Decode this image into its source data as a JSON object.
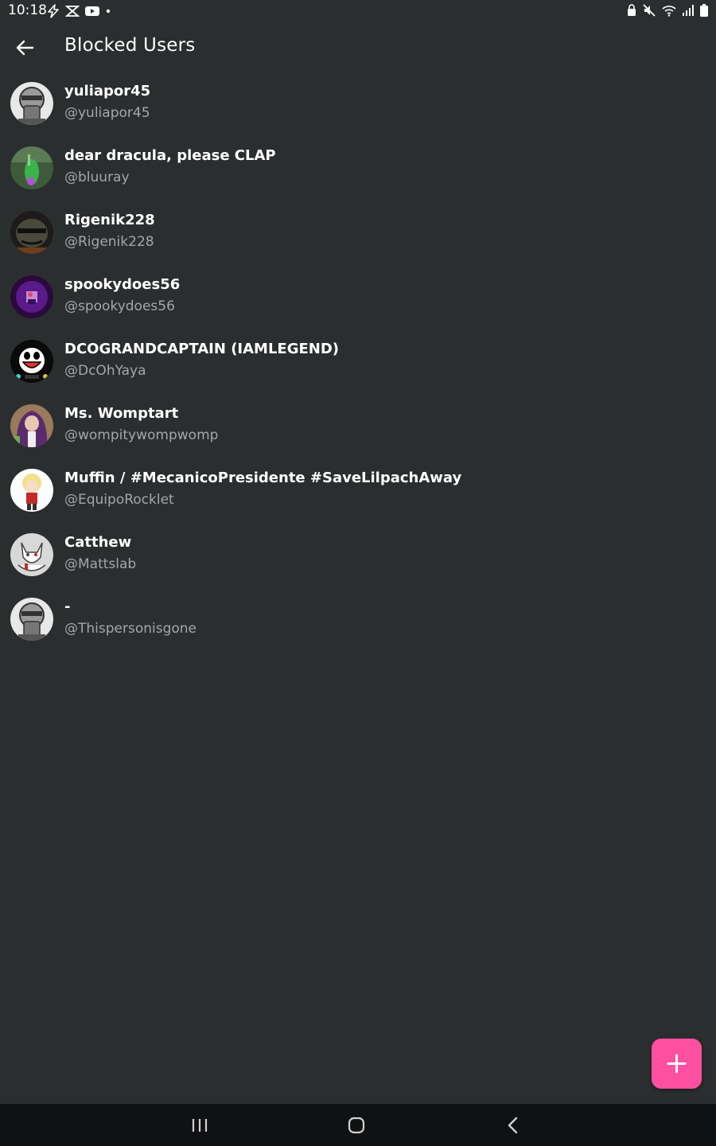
{
  "status_bar": {
    "time": "10:18",
    "left_icons": [
      "bolt-icon",
      "mail-icon",
      "youtube-icon",
      "dot-icon"
    ],
    "right_icons": [
      "lock-icon",
      "mute-icon",
      "wifi-icon",
      "signal-icon",
      "battery-icon"
    ]
  },
  "header": {
    "back_icon": "arrow-left-icon",
    "title": "Blocked Users"
  },
  "users": [
    {
      "name": "yuliapor45",
      "handle": "@yuliapor45",
      "avatar": "default-avatar"
    },
    {
      "name": "dear dracula, please CLAP",
      "handle": "@bluuray",
      "avatar": "green-figure-avatar"
    },
    {
      "name": "Rigenik228",
      "handle": "@Rigenik228",
      "avatar": "dark-character-avatar"
    },
    {
      "name": "spookydoes56",
      "handle": "@spookydoes56",
      "avatar": "purple-avatar"
    },
    {
      "name": "DCOGRANDCAPTAIN (IAMLEGEND)",
      "handle": "@DcOhYaya",
      "avatar": "cartoon-face-avatar"
    },
    {
      "name": "Ms. Womptart",
      "handle": "@wompitywompwomp",
      "avatar": "purple-hair-avatar"
    },
    {
      "name": "Muffin / #MecanicoPresidente #SaveLilpachAway",
      "handle": "@EquipoRocklet",
      "avatar": "blonde-character-avatar"
    },
    {
      "name": "Catthew",
      "handle": "@Mattslab",
      "avatar": "white-cat-avatar"
    },
    {
      "name": "-",
      "handle": "@Thispersonisgone",
      "avatar": "default-avatar"
    }
  ],
  "fab": {
    "icon": "plus-icon"
  },
  "nav_bar": {
    "icons": [
      "recents-icon",
      "home-icon",
      "back-chevron-icon"
    ]
  },
  "colors": {
    "background": "#2b2e2f",
    "text_primary": "#ffffff",
    "text_secondary": "#a4a7a8",
    "accent": "#ff4fa0",
    "nav_bar": "#101112"
  }
}
